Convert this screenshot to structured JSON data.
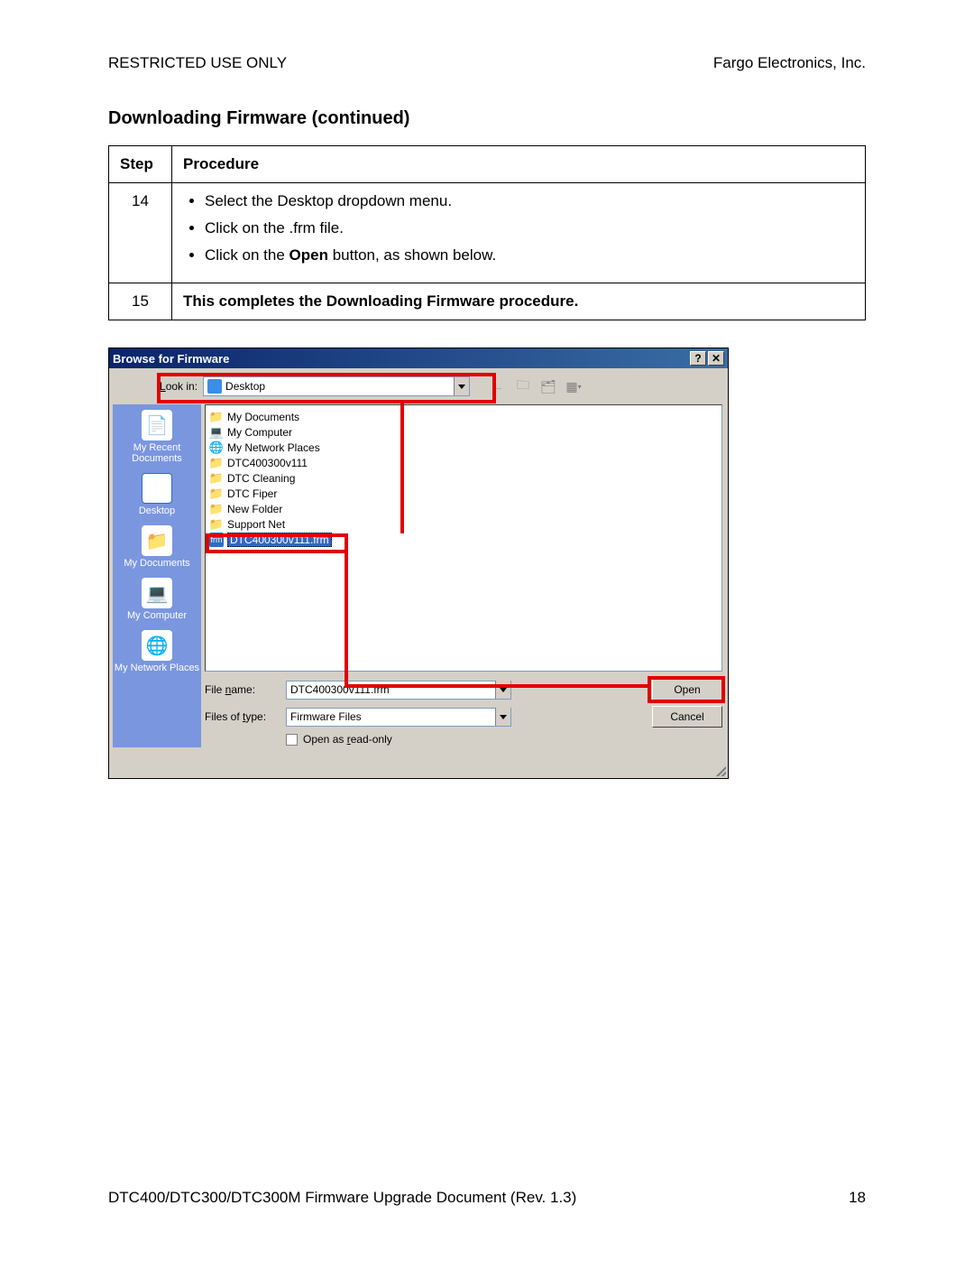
{
  "header": {
    "left": "RESTRICTED USE ONLY",
    "right": "Fargo Electronics, Inc."
  },
  "section_title": "Downloading Firmware (continued)",
  "table": {
    "col_step": "Step",
    "col_proc": "Procedure",
    "rows": [
      {
        "step": "14",
        "bullets": [
          "Select the Desktop dropdown menu.",
          "Click on the .frm file.",
          "Click on the Open button, as shown below."
        ],
        "bold_word_in_bullet3": "Open"
      },
      {
        "step": "15",
        "text": "This completes the Downloading Firmware procedure."
      }
    ]
  },
  "dialog": {
    "title": "Browse for Firmware",
    "lookin_label": "Look in:",
    "lookin_value": "Desktop",
    "sidebar": [
      "My Recent Documents",
      "Desktop",
      "My Documents",
      "My Computer",
      "My Network Places"
    ],
    "files": [
      "My Documents",
      "My Computer",
      "My Network Places",
      "DTC400300v111",
      "DTC Cleaning",
      "DTC Fiper",
      "New Folder",
      "Support Net",
      "DTC400300v111.frm"
    ],
    "selected_file_index": 8,
    "filename_label": "File name:",
    "filename_value": "DTC400300v111.frm",
    "filetype_label": "Files of type:",
    "filetype_value": "Firmware Files",
    "readonly_label": "Open as read-only",
    "open_btn": "Open",
    "cancel_btn": "Cancel"
  },
  "footer": {
    "left": "DTC400/DTC300/DTC300M Firmware Upgrade Document (Rev. 1.3)",
    "right": "18"
  }
}
